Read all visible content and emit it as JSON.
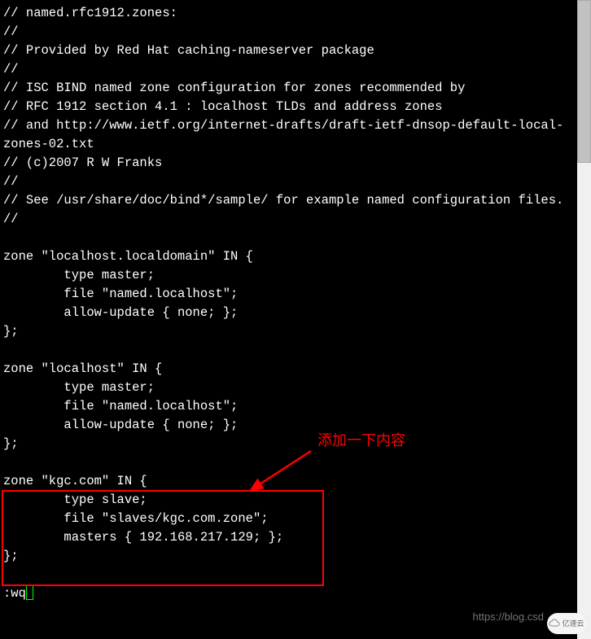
{
  "code": {
    "lines": [
      "// named.rfc1912.zones:",
      "//",
      "// Provided by Red Hat caching-nameserver package",
      "//",
      "// ISC BIND named zone configuration for zones recommended by",
      "// RFC 1912 section 4.1 : localhost TLDs and address zones",
      "// and http://www.ietf.org/internet-drafts/draft-ietf-dnsop-default-local-zones-02.txt",
      "// (c)2007 R W Franks",
      "//",
      "// See /usr/share/doc/bind*/sample/ for example named configuration files.",
      "//",
      "",
      "zone \"localhost.localdomain\" IN {",
      "        type master;",
      "        file \"named.localhost\";",
      "        allow-update { none; };",
      "};",
      "",
      "zone \"localhost\" IN {",
      "        type master;",
      "        file \"named.localhost\";",
      "        allow-update { none; };",
      "};",
      "",
      "zone \"kgc.com\" IN {",
      "        type slave;",
      "        file \"slaves/kgc.com.zone\";",
      "        masters { 192.168.217.129; };",
      "};"
    ]
  },
  "vim": {
    "command": ":wq"
  },
  "annotation": {
    "label": "添加一下内容",
    "box_color": "#ff0000"
  },
  "watermark": {
    "text": "https://blog.csd",
    "badge_text": "亿速云"
  },
  "highlighted_zone": {
    "name": "kgc.com",
    "type": "slave",
    "file": "slaves/kgc.com.zone",
    "masters": "192.168.217.129"
  }
}
